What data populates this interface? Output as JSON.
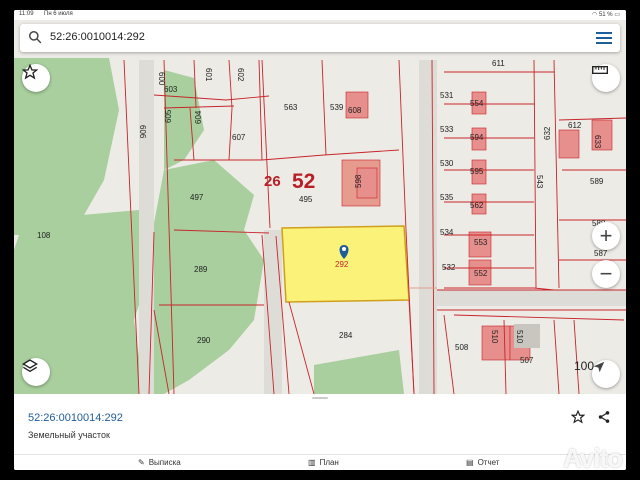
{
  "status_bar": {
    "time": "11:09",
    "date": "Пн 6 июля",
    "battery": "51 %"
  },
  "search": {
    "query": "52:26:0010014:292"
  },
  "map": {
    "parcel_labels": {
      "l611": "611",
      "l600": "600",
      "l603": "603",
      "l601": "601",
      "l602": "602",
      "l563": "563",
      "l539": "539",
      "l608": "608",
      "l531": "531",
      "l554": "554",
      "l533": "533",
      "l594": "594",
      "l612": "612",
      "l633": "633",
      "l632": "632",
      "l606": "606",
      "l605": "605",
      "l604": "604",
      "l607": "607",
      "l530": "530",
      "l595": "595",
      "l543": "543",
      "l589": "589",
      "l497": "497",
      "l495": "495",
      "l598": "598",
      "l535": "535",
      "l562": "562",
      "l588": "588",
      "l108": "108",
      "l534": "534",
      "l553": "553",
      "l587": "587",
      "l532": "532",
      "l552": "552",
      "l289": "289",
      "l292": "292",
      "l284": "284",
      "l290": "290",
      "l508": "508",
      "l510a": "510",
      "l510b": "510",
      "l507": "507",
      "l1000": "100"
    },
    "quarter_label": "26",
    "region_label": "52",
    "selected_parcel_color": "#fbf27a",
    "boundary_color": "#c8242a",
    "icons": {
      "favorite": "star-outline-icon",
      "layers": "layers-icon",
      "ruler": "ruler-icon",
      "locate": "navigation-arrow-icon"
    },
    "zoom_in": "+",
    "zoom_out": "−"
  },
  "panel": {
    "cadastral_number": "52:26:0010014:292",
    "object_type": "Земельный участок",
    "actions": {
      "extract": "Выписка",
      "plan": "План",
      "report": "Отчет"
    }
  },
  "watermark": "Avito"
}
